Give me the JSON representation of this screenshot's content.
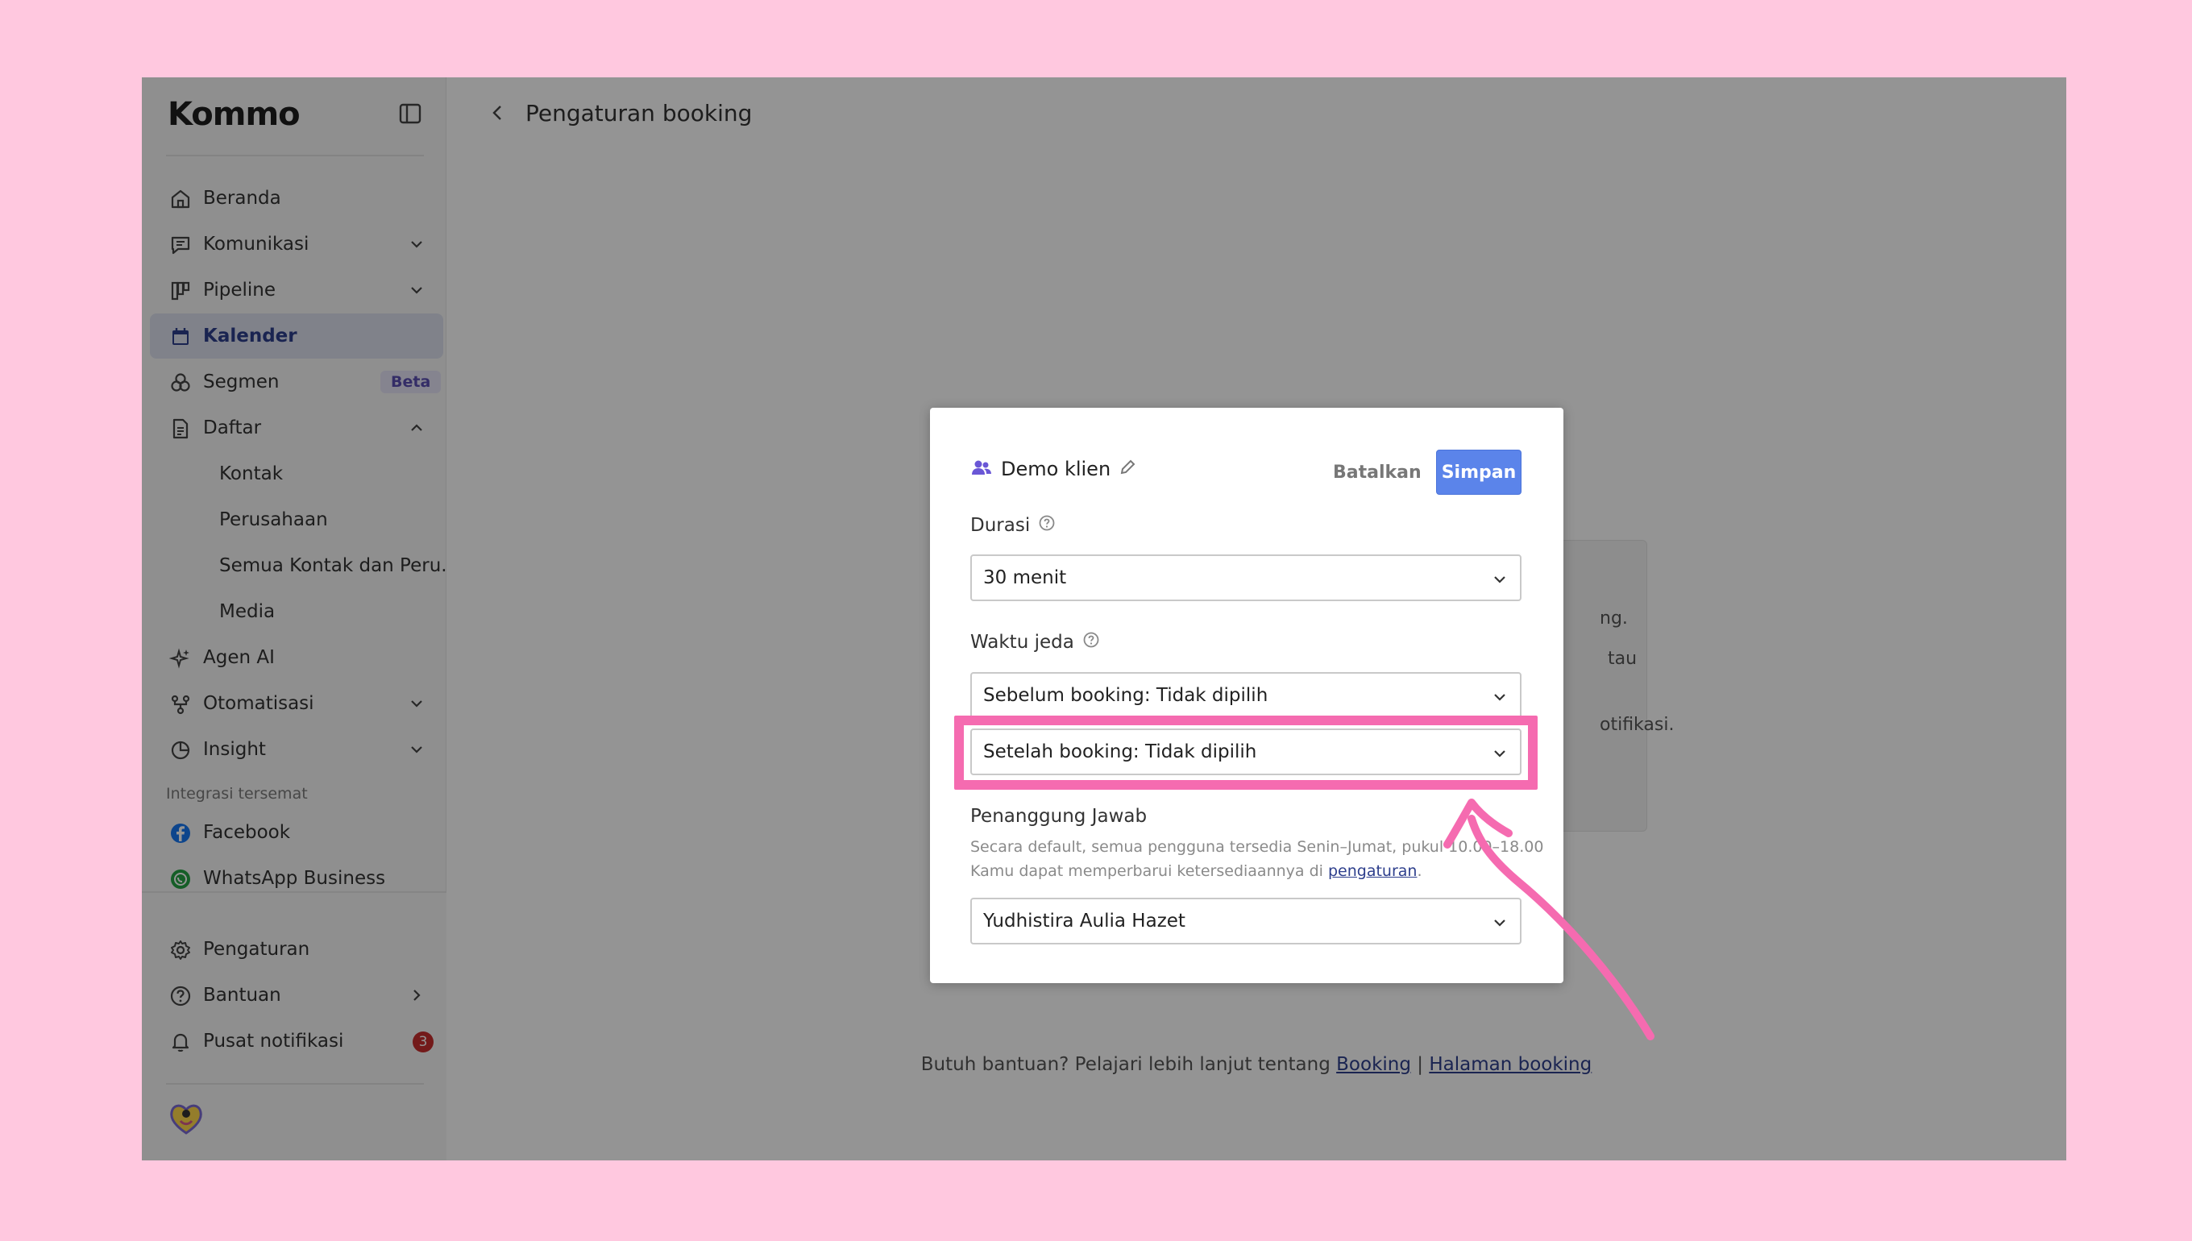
{
  "brand": {
    "logo_text": "Kommo"
  },
  "sidebar": {
    "items": [
      {
        "label": "Beranda",
        "icon": "home-icon"
      },
      {
        "label": "Komunikasi",
        "icon": "chat-icon"
      },
      {
        "label": "Pipeline",
        "icon": "pipeline-icon"
      },
      {
        "label": "Kalender",
        "icon": "calendar-icon",
        "active": true
      },
      {
        "label": "Segmen",
        "icon": "segments-icon",
        "badge": "Beta"
      },
      {
        "label": "Daftar",
        "icon": "document-icon"
      },
      {
        "label": "Kontak"
      },
      {
        "label": "Perusahaan"
      },
      {
        "label": "Semua Kontak dan Peru..."
      },
      {
        "label": "Media"
      },
      {
        "label": "Agen AI",
        "icon": "sparkle-icon"
      },
      {
        "label": "Otomatisasi",
        "icon": "automation-icon"
      },
      {
        "label": "Insight",
        "icon": "chart-pie-icon"
      }
    ],
    "section_label": "Integrasi tersemat",
    "integrations": [
      {
        "label": "Facebook",
        "icon": "facebook-icon",
        "color": "#1877f2"
      },
      {
        "label": "WhatsApp Business",
        "icon": "whatsapp-icon",
        "color": "#25a244"
      }
    ],
    "bottom": [
      {
        "label": "Pengaturan",
        "icon": "gear-icon"
      },
      {
        "label": "Bantuan",
        "icon": "help-icon"
      },
      {
        "label": "Pusat notifikasi",
        "icon": "bell-icon",
        "badge": "3"
      }
    ]
  },
  "header": {
    "title": "Pengaturan booking"
  },
  "background_card": {
    "lines": [
      "ng.",
      "tau",
      "otifikasi."
    ]
  },
  "footer": {
    "text": "Butuh bantuan? Pelajari lebih lanjut tentang",
    "link1": "Booking",
    "separator": "|",
    "link2": "Halaman booking"
  },
  "modal": {
    "title": "Demo klien",
    "cancel_label": "Batalkan",
    "save_label": "Simpan",
    "duration": {
      "label": "Durasi",
      "value": "30 menit"
    },
    "buffer": {
      "label": "Waktu jeda",
      "before": "Sebelum booking: Tidak dipilih",
      "after": "Setelah booking: Tidak dipilih"
    },
    "owner": {
      "label": "Penanggung Jawab",
      "hint_line1": "Secara default, semua pengguna tersedia Senin–Jumat, pukul 10.00–18.00",
      "hint_line2_prefix": "Kamu dapat memperbarui ketersediaannya di",
      "hint_link": "pengaturan",
      "hint_line2_suffix": ".",
      "value": "Yudhistira Aulia Hazet"
    }
  },
  "colors": {
    "accent": "#5b84ea",
    "highlight": "#f56bb0",
    "page_bg": "#ffc8df",
    "active_nav": "#2d3e8c"
  }
}
